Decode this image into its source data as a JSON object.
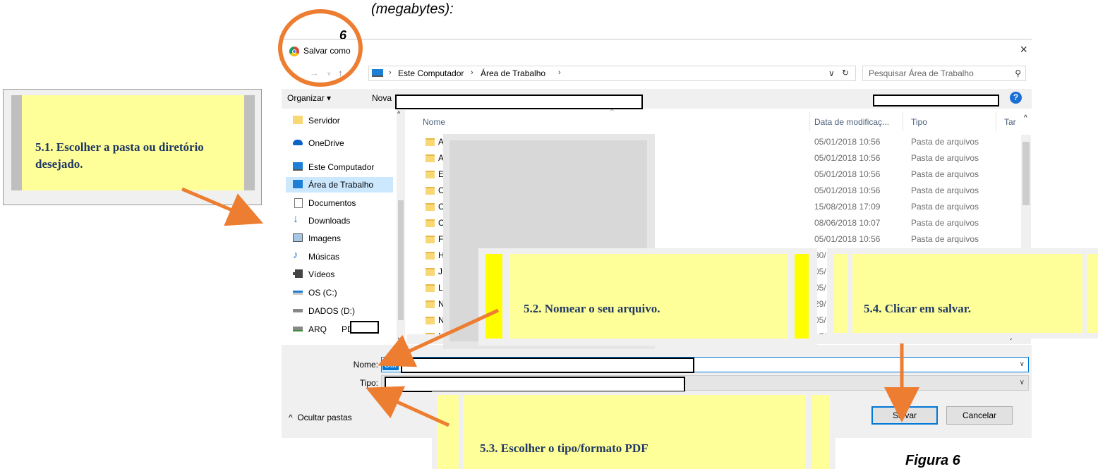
{
  "captions": {
    "top": "(megabytes):",
    "stray_digit": "6",
    "bottom": "Figura 6"
  },
  "dialog": {
    "title": "Salvar como",
    "close_glyph": "×",
    "breadcrumb": [
      "Este Computador",
      "Área de Trabalho"
    ],
    "search_placeholder": "Pesquisar Área de Trabalho",
    "toolbar": {
      "organize": "Organizar ▾",
      "new_folder": "Nova",
      "help": "?"
    },
    "nav_items": [
      {
        "label": "Servidor",
        "icon": "folder-icon"
      },
      {
        "label": "OneDrive",
        "icon": "cloud-icon"
      },
      {
        "label": "Este Computador",
        "icon": "computer-icon"
      },
      {
        "label": "Área de Trabalho",
        "icon": "desktop-icon",
        "selected": true
      },
      {
        "label": "Documentos",
        "icon": "document-icon"
      },
      {
        "label": "Downloads",
        "icon": "download-icon"
      },
      {
        "label": "Imagens",
        "icon": "image-icon"
      },
      {
        "label": "Músicas",
        "icon": "music-icon"
      },
      {
        "label": "Vídeos",
        "icon": "video-icon"
      },
      {
        "label": "OS (C:)",
        "icon": "drive-icon"
      },
      {
        "label": "DADOS (D:)",
        "icon": "drive-icon"
      },
      {
        "label": "ARQ",
        "suffix": "PD",
        "icon": "network-drive-icon"
      }
    ],
    "columns": {
      "name": "Nome",
      "date": "Data de modificaç...",
      "type": "Tipo",
      "size": "Tar"
    },
    "files": [
      {
        "initial": "A",
        "date": "05/01/2018 10:56",
        "type": "Pasta de arquivos"
      },
      {
        "initial": "A",
        "date": "05/01/2018 10:56",
        "type": "Pasta de arquivos"
      },
      {
        "initial": "E",
        "date": "05/01/2018 10:56",
        "type": "Pasta de arquivos"
      },
      {
        "initial": "C",
        "date": "05/01/2018 10:56",
        "type": "Pasta de arquivos"
      },
      {
        "initial": "C",
        "date": "15/08/2018 17:09",
        "type": "Pasta de arquivos"
      },
      {
        "initial": "C",
        "date": "08/06/2018 10:07",
        "type": "Pasta de arquivos"
      },
      {
        "initial": "F",
        "date": "05/01/2018 10:56",
        "type": "Pasta de arquivos"
      },
      {
        "initial": "H",
        "date": "30/",
        "type": ""
      },
      {
        "initial": "J",
        "date": "05/",
        "type": ""
      },
      {
        "initial": "L",
        "date": "05/",
        "type": ""
      },
      {
        "initial": "N",
        "date": "29/",
        "type": ""
      },
      {
        "initial": "N",
        "date": "05/",
        "type": ""
      },
      {
        "initial": "N",
        "date": "17/",
        "type": ""
      }
    ],
    "name_label": "Nome:",
    "name_value": "Cur",
    "type_label": "Tipo:",
    "hide_folders": "Ocultar pastas",
    "save_button": "Salvar",
    "cancel_button": "Cancelar"
  },
  "callouts": {
    "c1": "5.1. Escolher a pasta ou diretório desejado.",
    "c2": "5.2. Nomear o seu arquivo.",
    "c3": "5.3. Escolher o tipo/formato PDF",
    "c4": "5.4. Clicar em salvar."
  },
  "colors": {
    "callout_fill": "#ffff99",
    "callout_text": "#1f3864",
    "arrow": "#ed7d31",
    "selection": "#cce8ff"
  }
}
